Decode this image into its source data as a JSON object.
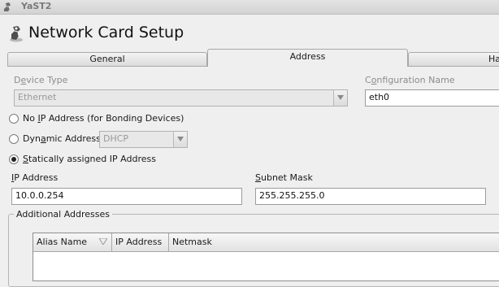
{
  "window": {
    "title": "YaST2"
  },
  "page": {
    "title": "Network Card Setup"
  },
  "tabs": [
    {
      "label": "General",
      "active": false
    },
    {
      "label": "Address",
      "active": true
    },
    {
      "label": "Ha",
      "active": false
    }
  ],
  "device_type": {
    "label_pre": "D",
    "label_acc": "e",
    "label_post": "vice Type",
    "value": "Ethernet"
  },
  "config_name": {
    "label_pre": "C",
    "label_acc": "o",
    "label_post": "nfiguration Name",
    "value": "eth0"
  },
  "address_mode": {
    "no_ip": {
      "label_pre": "No ",
      "label_acc": "I",
      "label_post": "P Address (for Bonding Devices)",
      "checked": false
    },
    "dynamic": {
      "label_pre": "Dyn",
      "label_acc": "a",
      "label_post": "mic Address",
      "checked": false,
      "method": "DHCP"
    },
    "static": {
      "label_pre": "",
      "label_acc": "S",
      "label_post": "tatically assigned IP Address",
      "checked": true
    }
  },
  "ip_address": {
    "label_pre": "",
    "label_acc": "I",
    "label_post": "P Address",
    "value": "10.0.0.254"
  },
  "subnet_mask": {
    "label_pre": "",
    "label_acc": "S",
    "label_post": "ubnet Mask",
    "value": "255.255.255.0"
  },
  "additional_addresses": {
    "title": "Additional Addresses",
    "columns": [
      "Alias Name",
      "IP Address",
      "Netmask"
    ],
    "rows": []
  },
  "colors": {
    "background": "#efefef",
    "field": "#ffffff",
    "disabled_text": "#8c8c8c"
  }
}
